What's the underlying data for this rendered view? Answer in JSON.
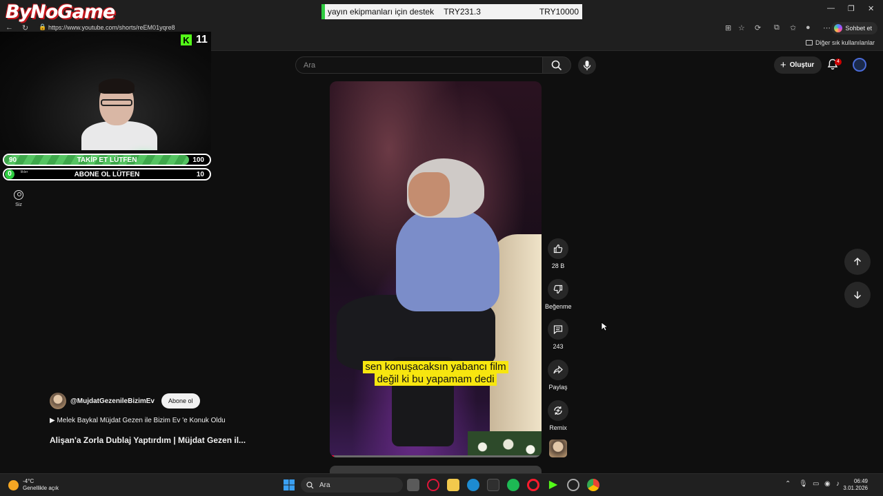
{
  "overlay": {
    "logo_text": "ByNoGame",
    "ticker": {
      "text": "yayın ekipmanları için destek",
      "amount1": "TRY231.3",
      "amount2": "TRY10000"
    },
    "kick_viewers": "11",
    "goals": [
      {
        "left": "90",
        "label": "TAKİP ET LÜTFEN",
        "right": "100",
        "progress": 0.9
      },
      {
        "left": "0",
        "label": "ABONE OL LÜTFEN",
        "right": "10",
        "progress": 0.0,
        "small_tag": "likler"
      }
    ]
  },
  "browser": {
    "url": "https://www.youtube.com/shorts/reEM01yqre8",
    "copilot_label": "Sohbet et",
    "bookmarks_folder": "Diğer sık kullanılanlar"
  },
  "youtube": {
    "search_placeholder": "Ara",
    "create_label": "Oluştur",
    "notification_count": "4",
    "sidebar_you": "Siz",
    "actions": {
      "like_count": "28 B",
      "dislike_label": "Beğenme",
      "comment_count": "243",
      "share_label": "Paylaş",
      "remix_label": "Remix"
    },
    "video": {
      "caption_line1": "sen konuşacaksın yabancı film",
      "caption_line2": "değil ki bu yapamam dedi",
      "progress": 0.02
    },
    "channel": {
      "handle": "@MujdatGezenileBizimEv",
      "subscribe_label": "Abone ol"
    },
    "playlist": "Melek Baykal Müjdat Gezen ile Bizim Ev 'e Konuk Oldu",
    "title": "Alişan'a Zorla Dublaj Yaptırdım | Müjdat Gezen il..."
  },
  "taskbar": {
    "temperature": "-4°C",
    "weather_desc": "Genellikle açık",
    "search_placeholder": "Ara",
    "time": "06:49",
    "date": "3.01.2026"
  }
}
